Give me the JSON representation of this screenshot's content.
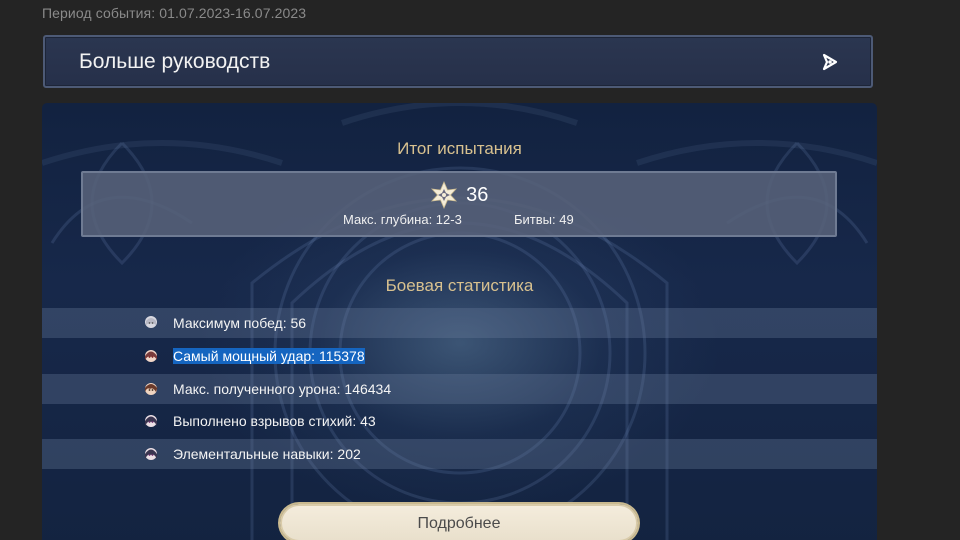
{
  "event_period": "Период события: 01.07.2023-16.07.2023",
  "guides_banner": {
    "title": "Больше руководств",
    "arrow_icon": "arrow-right-icon"
  },
  "summary": {
    "title": "Итог испытания",
    "star_icon": "abyss-star-icon",
    "stars": "36",
    "max_depth": "Макс. глубина: 12-3",
    "battles": "Битвы: 49"
  },
  "combat_stats": {
    "title": "Боевая статистика",
    "rows": [
      {
        "label": "Максимум побед: 56",
        "avatar": "character-avatar-icon",
        "color": "#d8d8e0"
      },
      {
        "label": "Самый мощный удар: 115378",
        "avatar": "character-avatar-icon",
        "color": "#7a3b3b"
      },
      {
        "label": "Макс. полученного урона: 146434",
        "avatar": "character-avatar-icon",
        "color": "#6b3a2a"
      },
      {
        "label": "Выполнено взрывов стихий: 43",
        "avatar": "character-avatar-icon",
        "color": "#3a3550"
      },
      {
        "label": "Элементальные навыки: 202",
        "avatar": "character-avatar-icon",
        "color": "#3a3550"
      }
    ]
  },
  "more_button": {
    "label": "Подробнее"
  },
  "colors": {
    "accent_gold": "#d8c18f",
    "selection": "#1565c0",
    "panel_bg": "#17284a"
  }
}
